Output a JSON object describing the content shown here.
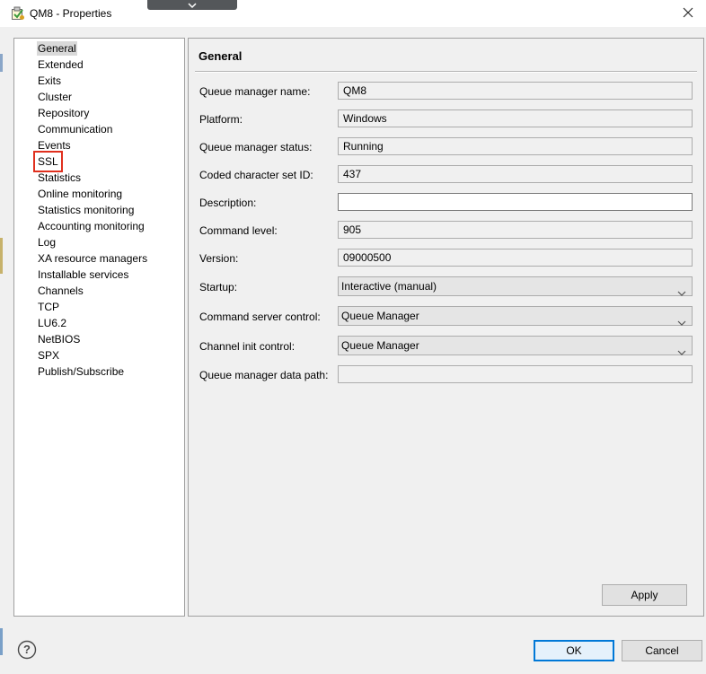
{
  "window": {
    "title": "QM8 - Properties"
  },
  "nav": {
    "items": [
      {
        "label": "General"
      },
      {
        "label": "Extended"
      },
      {
        "label": "Exits"
      },
      {
        "label": "Cluster"
      },
      {
        "label": "Repository"
      },
      {
        "label": "Communication"
      },
      {
        "label": "Events"
      },
      {
        "label": "SSL"
      },
      {
        "label": "Statistics"
      },
      {
        "label": "Online monitoring"
      },
      {
        "label": "Statistics monitoring"
      },
      {
        "label": "Accounting monitoring"
      },
      {
        "label": "Log"
      },
      {
        "label": "XA resource managers"
      },
      {
        "label": "Installable services"
      },
      {
        "label": "Channels"
      },
      {
        "label": "TCP"
      },
      {
        "label": "LU6.2"
      },
      {
        "label": "NetBIOS"
      },
      {
        "label": "SPX"
      },
      {
        "label": "Publish/Subscribe"
      }
    ],
    "selected": "General",
    "highlighted": "SSL"
  },
  "content": {
    "title": "General",
    "fields": {
      "qm_name": {
        "label": "Queue manager name:",
        "value": "QM8"
      },
      "platform": {
        "label": "Platform:",
        "value": "Windows"
      },
      "status": {
        "label": "Queue manager status:",
        "value": "Running"
      },
      "ccsid": {
        "label": "Coded character set ID:",
        "value": "437"
      },
      "description": {
        "label": "Description:",
        "value": ""
      },
      "command_level": {
        "label": "Command level:",
        "value": "905"
      },
      "version": {
        "label": "Version:",
        "value": "09000500"
      },
      "startup": {
        "label": "Startup:",
        "value": "Interactive (manual)"
      },
      "cmd_server": {
        "label": "Command server control:",
        "value": "Queue Manager"
      },
      "chinit": {
        "label": "Channel init control:",
        "value": "Queue Manager"
      },
      "data_path": {
        "label": "Queue manager data path:",
        "value": ""
      }
    },
    "apply_label": "Apply"
  },
  "footer": {
    "help_glyph": "?",
    "ok_label": "OK",
    "cancel_label": "Cancel"
  },
  "colors": {
    "highlight_box": "#e0301e",
    "primary_border": "#0078d7",
    "selected_bg": "#d9d9d9"
  },
  "icons": {
    "app": "properties-app-icon",
    "close": "close-icon",
    "dropdown": "chevron-down-icon",
    "help": "help-icon"
  }
}
